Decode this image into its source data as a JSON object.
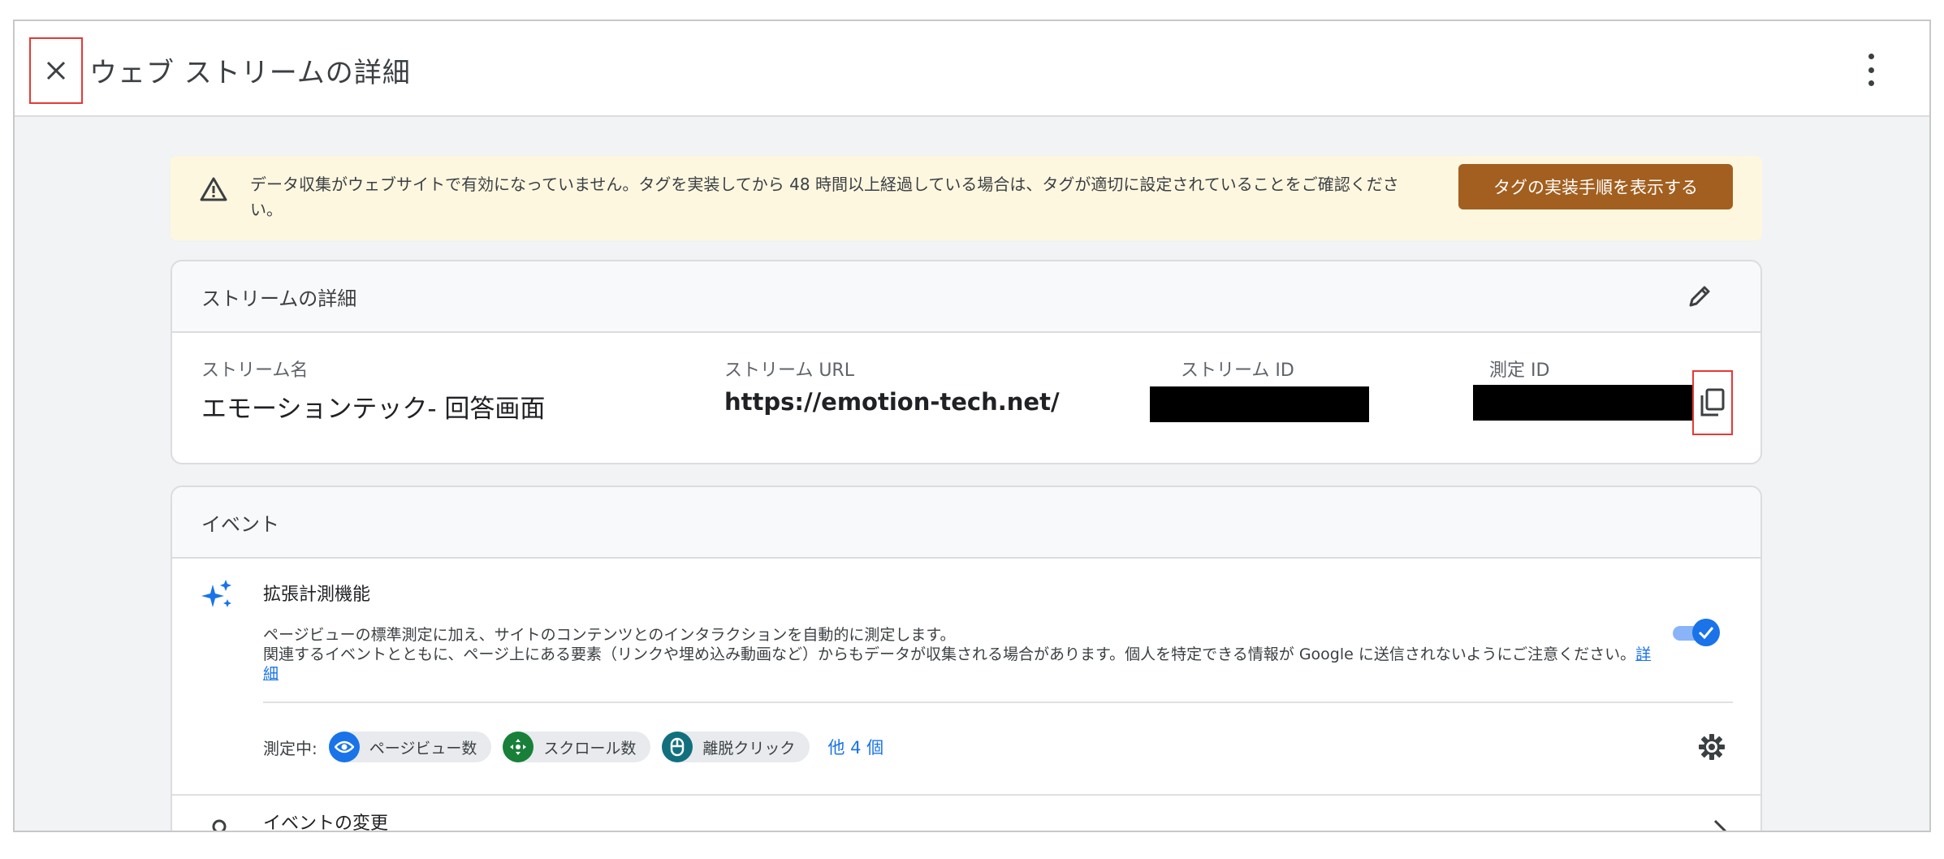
{
  "header": {
    "title": "ウェブ ストリームの詳細"
  },
  "banner": {
    "text": "データ収集がウェブサイトで有効になっていません。タグを実装してから 48 時間以上経過している場合は、タグが適切に設定されていることをご確認ください。",
    "button_label": "タグの実装手順を表示する",
    "accent_color": "#a35f1f"
  },
  "stream_details": {
    "title": "ストリームの詳細",
    "fields": [
      {
        "label": "ストリーム名",
        "value": "エモーションテック- 回答画面"
      },
      {
        "label": "ストリーム URL",
        "value": "https://emotion-tech.net/"
      },
      {
        "label": "ストリーム ID",
        "value": ""
      },
      {
        "label": "測定 ID",
        "value": ""
      }
    ]
  },
  "events": {
    "title": "イベント",
    "enhanced": {
      "title": "拡張計測機能",
      "desc_line1": "ページビューの標準測定に加え、サイトのコンテンツとのインタラクションを自動的に測定します。",
      "desc_line2": "関連するイベントとともに、ページ上にある要素（リンクや埋め込み動画など）からもデータが収集される場合があります。個人を特定できる情報が Google に送信されないようにご注意ください。",
      "link_text": "詳細",
      "enabled": true
    },
    "measuring_label": "測定中:",
    "chips": [
      {
        "label": "ページビュー数",
        "icon": "eye-icon",
        "color": "#1a73e8"
      },
      {
        "label": "スクロール数",
        "icon": "scroll-arrows-icon",
        "color": "#188038"
      },
      {
        "label": "離脱クリック",
        "icon": "mouse-icon",
        "color": "#12707e"
      }
    ],
    "more_label": "他 4 個",
    "change_label": "イベントの変更"
  }
}
